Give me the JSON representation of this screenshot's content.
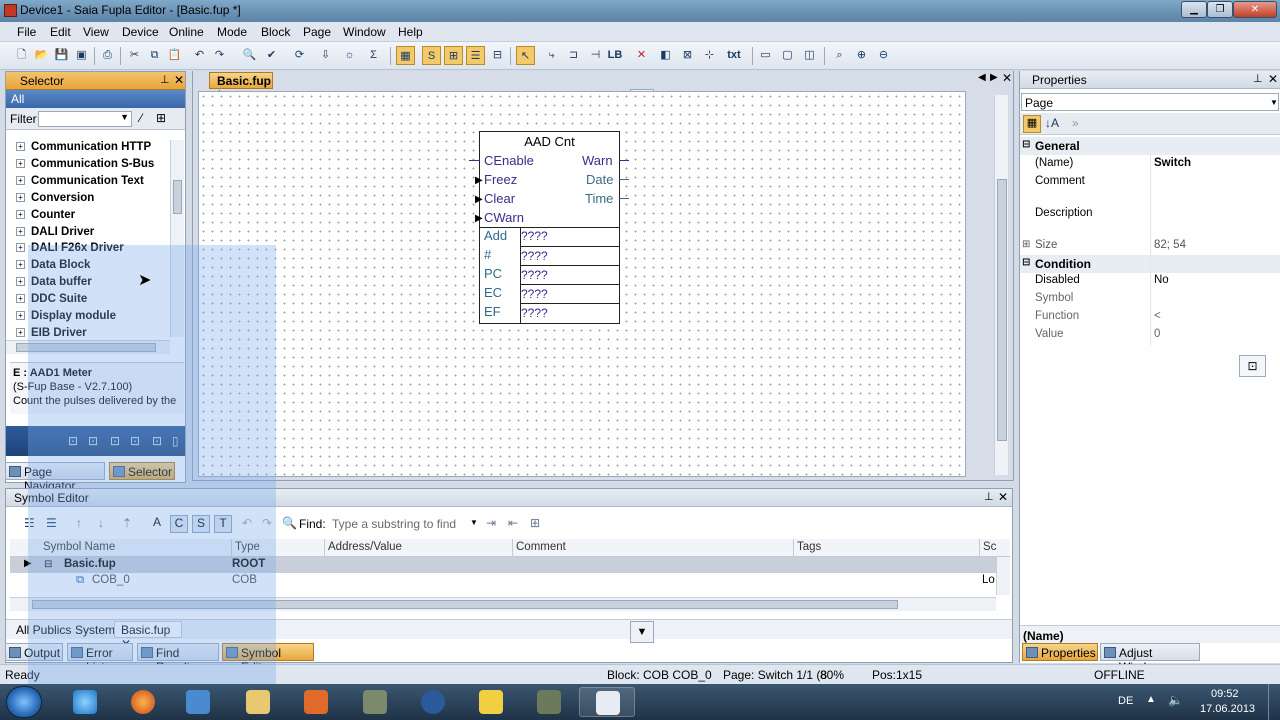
{
  "window": {
    "title": "Device1 - Saia Fupla Editor - [Basic.fup *]"
  },
  "menu": [
    "File",
    "Edit",
    "View",
    "Device",
    "Online",
    "Mode",
    "Block",
    "Page",
    "Window",
    "Help"
  ],
  "toolbar": {
    "text_button": "txt",
    "lb_button": "LB"
  },
  "selector": {
    "title": "Selector",
    "all_label": "All",
    "filter_label": "Filter",
    "items": [
      "Communication HTTP",
      "Communication S-Bus",
      "Communication Text",
      "Conversion",
      "Counter",
      "DALI Driver",
      "DALI F26x Driver",
      "Data Block",
      "Data buffer",
      "DDC Suite",
      "Display module",
      "EIB Driver"
    ],
    "info_title": "E    : AAD1 Meter",
    "info_version": "(S-Fup Base - V2.7.100)",
    "info_desc": "Count the pulses delivered by the"
  },
  "left_tabs": {
    "page_navigator": "Page Navigator",
    "selector": "Selector"
  },
  "editor": {
    "tab": "Basic.fup *",
    "block": {
      "title": "AAD Cnt",
      "inputs": [
        "CEnable",
        "Freez",
        "Clear",
        "CWarn"
      ],
      "outputs": [
        "Warn",
        "Date",
        "Time"
      ],
      "params": [
        {
          "name": "Add",
          "value": "????"
        },
        {
          "name": "#",
          "value": "????"
        },
        {
          "name": "PC",
          "value": "????"
        },
        {
          "name": "EC",
          "value": "????"
        },
        {
          "name": "EF",
          "value": "????"
        }
      ]
    }
  },
  "properties": {
    "title": "Properties",
    "selector_value": "Page",
    "general": "General",
    "rows": [
      {
        "key": "(Name)",
        "value": "Switch"
      },
      {
        "key": "Comment",
        "value": ""
      },
      {
        "key": "Description",
        "value": ""
      },
      {
        "key": "Size",
        "value": "82; 54"
      }
    ],
    "condition": "Condition",
    "cond_rows": [
      {
        "key": "Disabled",
        "value": "No"
      },
      {
        "key": "Symbol",
        "value": ""
      },
      {
        "key": "Function",
        "value": "<"
      },
      {
        "key": "Value",
        "value": "0"
      }
    ],
    "footer_name": "(Name)",
    "tabs": {
      "properties": "Properties",
      "adjust": "Adjust Window"
    }
  },
  "symbol_editor": {
    "title": "Symbol Editor",
    "find_label": "Find:",
    "find_placeholder": "Type a substring to find",
    "toolbar_letters": [
      "A",
      "C",
      "S",
      "T"
    ],
    "columns": [
      "Symbol Name",
      "Type",
      "Address/Value",
      "Comment",
      "Tags",
      "Sc"
    ],
    "rows": [
      {
        "name": "Basic.fup",
        "type": "ROOT",
        "sc": ""
      },
      {
        "name": "COB_0",
        "type": "COB",
        "sc": "Lo"
      }
    ],
    "tabs": [
      "All Publics",
      "System",
      "Basic.fup"
    ]
  },
  "bottom_tabs": [
    "Output",
    "Error List",
    "Find Results",
    "Symbol Editor"
  ],
  "status": {
    "ready": "Ready",
    "block": "Block: COB COB_0",
    "page": "Page: Switch 1/1 (8",
    "zoom": "80%",
    "pos": "Pos:1x15",
    "mode": "OFFLINE"
  },
  "taskbar": {
    "lang": "DE",
    "time": "09:52",
    "date": "17.06.2013"
  }
}
